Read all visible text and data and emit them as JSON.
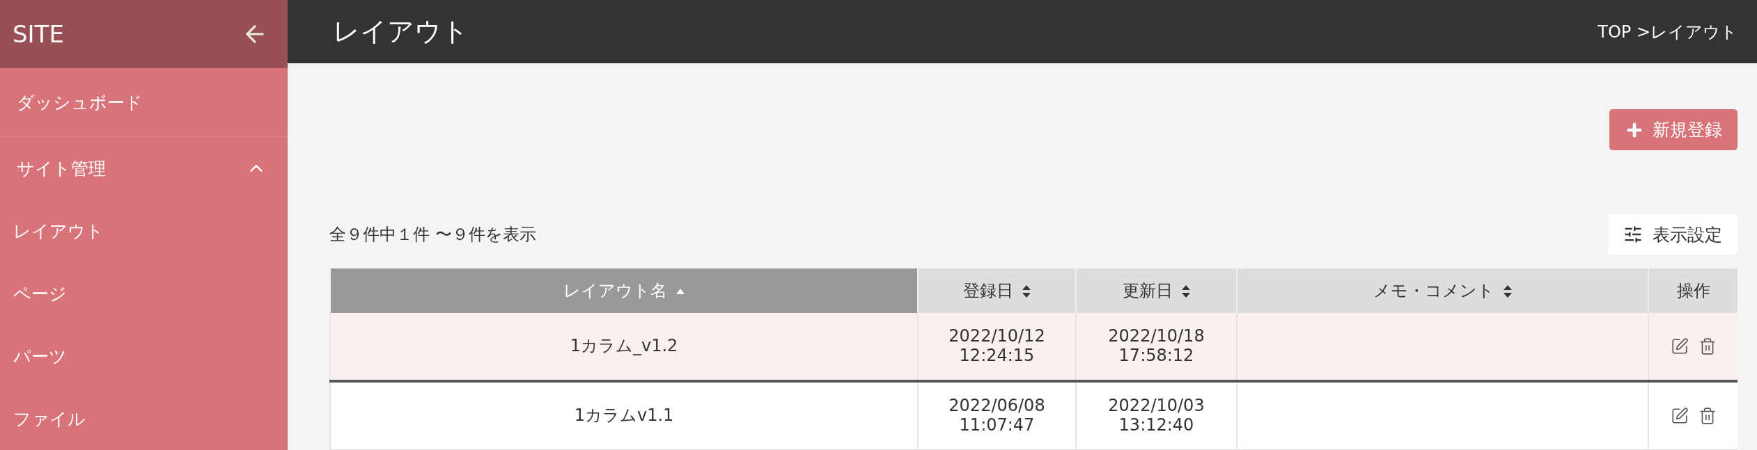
{
  "sidebar": {
    "title": "SITE",
    "items": [
      {
        "label": "ダッシュボード",
        "kind": "top"
      },
      {
        "label": "サイト管理",
        "kind": "group",
        "expanded": true,
        "children": [
          {
            "label": "レイアウト"
          },
          {
            "label": "ページ"
          },
          {
            "label": "パーツ"
          },
          {
            "label": "ファイル"
          }
        ]
      }
    ]
  },
  "header": {
    "title": "レイアウト",
    "breadcrumb": "TOP >レイアウト"
  },
  "new_button": {
    "label": "新規登録"
  },
  "count_text": "全９件中１件 〜９件を表示",
  "settings_button": {
    "label": "表示設定"
  },
  "table": {
    "columns": [
      {
        "label": "レイアウト名",
        "sortable": true,
        "sorted": true
      },
      {
        "label": "登録日",
        "sortable": true,
        "sorted": false
      },
      {
        "label": "更新日",
        "sortable": true,
        "sorted": false
      },
      {
        "label": "メモ・コメント",
        "sortable": true,
        "sorted": false
      },
      {
        "label": "操作",
        "sortable": false,
        "sorted": false
      }
    ],
    "rows": [
      {
        "name": "1カラム_v1.2",
        "created": [
          "2022/10/12",
          "12:24:15"
        ],
        "updated": [
          "2022/10/18",
          "17:58:12"
        ],
        "selected": true
      },
      {
        "name": "1カラムv1.1",
        "created": [
          "2022/06/08",
          "11:07:47"
        ],
        "updated": [
          "2022/10/03",
          "13:12:40"
        ],
        "selected": false
      }
    ]
  }
}
